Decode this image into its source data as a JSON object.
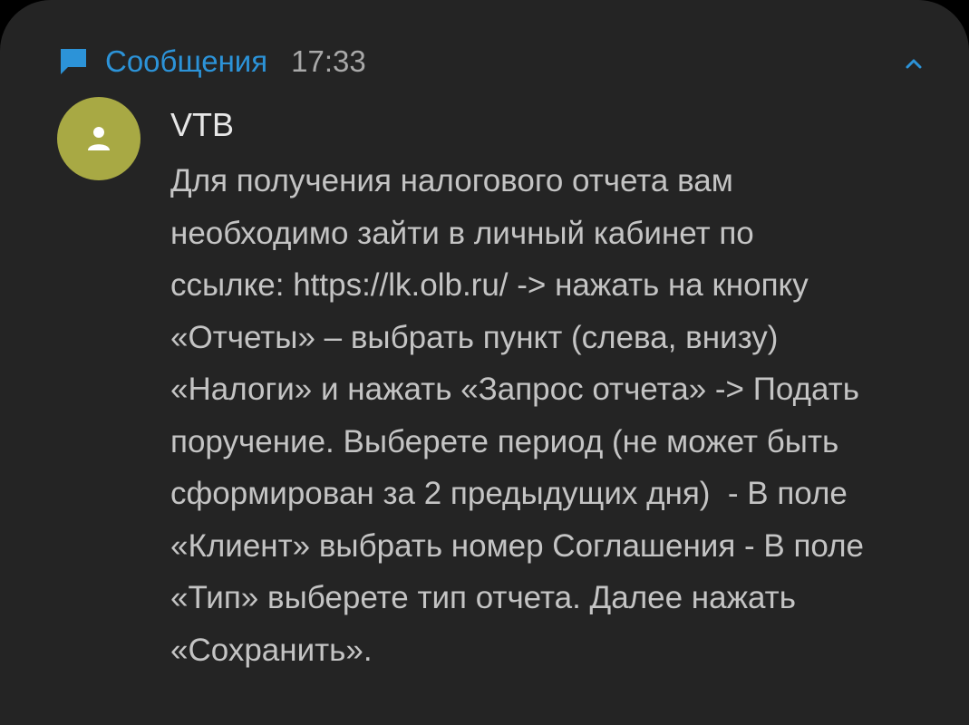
{
  "notification": {
    "app_name": "Сообщения",
    "time": "17:33",
    "app_icon": "chat-bubble-icon",
    "collapse_icon": "chevron-up-icon",
    "accent_color": "#2c93d8",
    "avatar_color": "#a8a944",
    "avatar_icon": "person-icon",
    "sender": "VTB",
    "message_lines": [
      "Для получения налогового отчета вам",
      "необходимо зайти в личный кабинет по",
      "ссылке: https://lk.olb.ru/ -> нажать на кнопку",
      "«Отчеты» – выбрать пункт (слева, внизу)",
      "«Налоги» и нажать «Запрос отчета» -> Подать",
      "поручение. Выберете период (не может быть",
      "сформирован за 2 предыдущих дня)  - В поле",
      "«Клиент» выбрать номер Соглашения - В поле",
      "«Тип» выберете тип отчета. Далее нажать",
      "«Сохранить»."
    ]
  }
}
